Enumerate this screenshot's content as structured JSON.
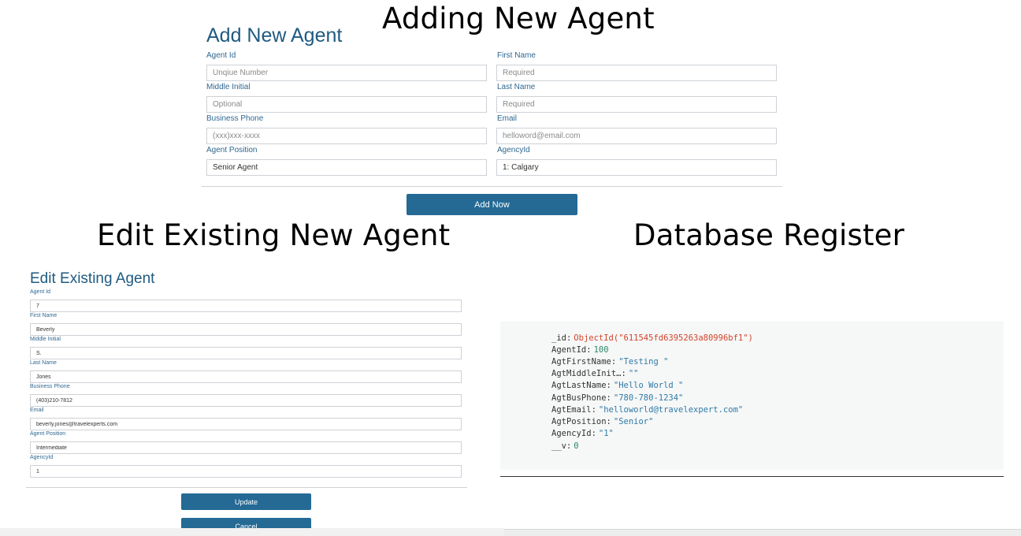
{
  "captions": {
    "adding": "Adding New Agent",
    "edit": "Edit Existing New Agent",
    "database": "Database Register"
  },
  "add_form": {
    "title": "Add New Agent",
    "agent_id": {
      "label": "Agent Id",
      "placeholder": "Unqiue Number",
      "value": ""
    },
    "first_name": {
      "label": "First Name",
      "placeholder": "Required",
      "value": ""
    },
    "middle_initial": {
      "label": "Middle Initial",
      "placeholder": "Optional",
      "value": ""
    },
    "last_name": {
      "label": "Last Name",
      "placeholder": "Required",
      "value": ""
    },
    "business_phone": {
      "label": "Business Phone",
      "placeholder": "(xxx)xxx-xxxx",
      "value": ""
    },
    "email": {
      "label": "Email",
      "placeholder": "helloword@email.com",
      "value": ""
    },
    "agent_position": {
      "label": "Agent Position",
      "value": "Senior Agent"
    },
    "agency_id": {
      "label": "AgencyId",
      "value": "1: Calgary"
    },
    "submit_label": "Add Now"
  },
  "edit_form": {
    "title": "Edit Existing Agent",
    "agent_id": {
      "label": "Agent Id",
      "value": "7"
    },
    "first_name": {
      "label": "First Name",
      "value": "Beverly"
    },
    "middle_initial": {
      "label": "Middle Initial",
      "value": "S."
    },
    "last_name": {
      "label": "Last Name",
      "value": "Jones"
    },
    "business_phone": {
      "label": "Business Phone",
      "value": "(403)210-7812"
    },
    "email": {
      "label": "Email",
      "value": "beverly.jones@travelexperts.com"
    },
    "agent_position": {
      "label": "Agent Position",
      "value": "Intermediate"
    },
    "agency_id": {
      "label": "AgencyId",
      "value": "1"
    },
    "update_label": "Update",
    "cancel_label": "Cancel"
  },
  "database": {
    "id": {
      "key": "_id",
      "value": "ObjectId(\"611545fd6395263a80996bf1\")"
    },
    "agent_id": {
      "key": "AgentId",
      "value": "100"
    },
    "first_name": {
      "key": "AgtFirstName",
      "value": "\"Testing \""
    },
    "middle_initial": {
      "key": "AgtMiddleInit…",
      "value": "\"\""
    },
    "last_name": {
      "key": "AgtLastName",
      "value": "\"Hello World \""
    },
    "bus_phone": {
      "key": "AgtBusPhone",
      "value": "\"780-780-1234\""
    },
    "email": {
      "key": "AgtEmail",
      "value": "\"helloworld@travelexpert.com\""
    },
    "position": {
      "key": "AgtPosition",
      "value": "\"Senior\""
    },
    "agency_id": {
      "key": "AgencyId",
      "value": "\"1\""
    },
    "version": {
      "key": "__v",
      "value": "0"
    }
  },
  "colors": {
    "title_blue": "#1f5a80",
    "label_blue": "#2f6790",
    "button_blue": "#246a95",
    "db_string": "#2f7ba8",
    "db_number": "#2a8a6a",
    "db_objectid": "#d2452c"
  }
}
